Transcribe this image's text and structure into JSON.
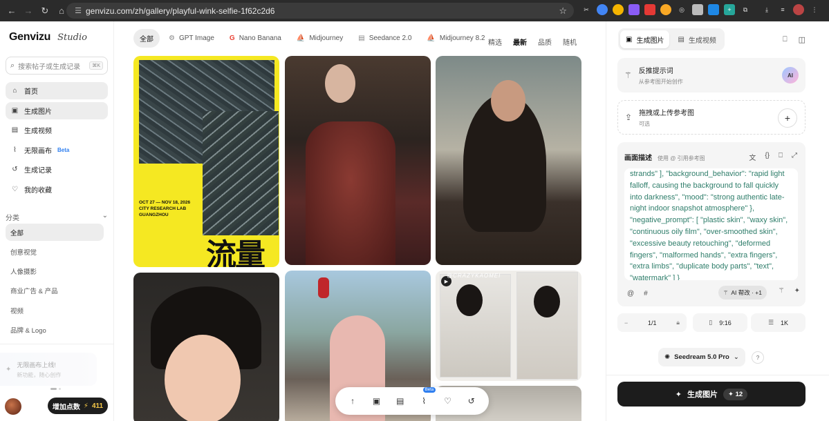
{
  "browser": {
    "url": "genvizu.com/zh/gallery/playful-wink-selfie-1f62c2d6"
  },
  "sidebar": {
    "logo": "Genvizu",
    "logo_sub": "Studio",
    "search_placeholder": "搜索帖子或生成记录",
    "search_shortcut": "⌘K",
    "menu": [
      {
        "label": "首页",
        "icon": "home-icon"
      },
      {
        "label": "生成图片",
        "icon": "image-icon"
      },
      {
        "label": "生成视频",
        "icon": "film-icon"
      },
      {
        "label": "无限画布",
        "icon": "canvas-icon",
        "badge": "Beta"
      },
      {
        "label": "生成记录",
        "icon": "history-icon"
      },
      {
        "label": "我的收藏",
        "icon": "heart-icon"
      }
    ],
    "category_title": "分类",
    "categories": [
      "全部",
      "创意视觉",
      "人像摄影",
      "商业广告 & 产品",
      "视频",
      "品牌 & Logo"
    ],
    "promo_title": "无限画布上线!",
    "promo_sub": "新功能，随心创作",
    "credits_label": "增加点数",
    "credits_value": "411"
  },
  "gallery": {
    "tabs": [
      "全部",
      "GPT Image",
      "Nano Banana",
      "Midjourney",
      "Seedance 2.0",
      "Midjourney 8.2"
    ],
    "sorts": [
      "精选",
      "最新",
      "品质",
      "随机"
    ],
    "poster_date": "OCT 27 — NOV 18, 2026\nCITY RESEARCH LAB\nGUANGZHOU",
    "poster_title": "流量",
    "sketch_caption": "@CRAZYKAOMEI",
    "toolbar_beta": "Beta"
  },
  "panel": {
    "modes": [
      "生成图片",
      "生成视频"
    ],
    "reverse_prompt_title": "反推提示词",
    "reverse_prompt_sub": "从参考图开始创作",
    "ai_badge": "AI",
    "upload_title": "拖拽或上传参考图",
    "upload_sub": "可选",
    "desc_title": "画面描述",
    "desc_hint": "使用 @ 引用参考图",
    "prompt_text": "strands\" ], \"background_behavior\": \"rapid light falloff, causing the background to fall quickly into darkness\", \"mood\": \"strong authentic late-night indoor snapshot atmosphere\" }, \"negative_prompt\": [ \"plastic skin\", \"waxy skin\", \"continuous oily film\", \"over-smoothed skin\", \"excessive beauty retouching\", \"deformed fingers\", \"malformed hands\", \"extra fingers\", \"extra limbs\", \"duplicate body parts\", \"text\", \"watermark\" ] }",
    "ai_help": "AI 帮改 · +1",
    "count": "1/1",
    "ratio": "9:16",
    "resolution": "1K",
    "model": "Seedream 5.0 Pro",
    "generate_label": "生成图片",
    "generate_cost": "12",
    "accent": "#2f7ff0",
    "credits_color": "#f7c948"
  }
}
